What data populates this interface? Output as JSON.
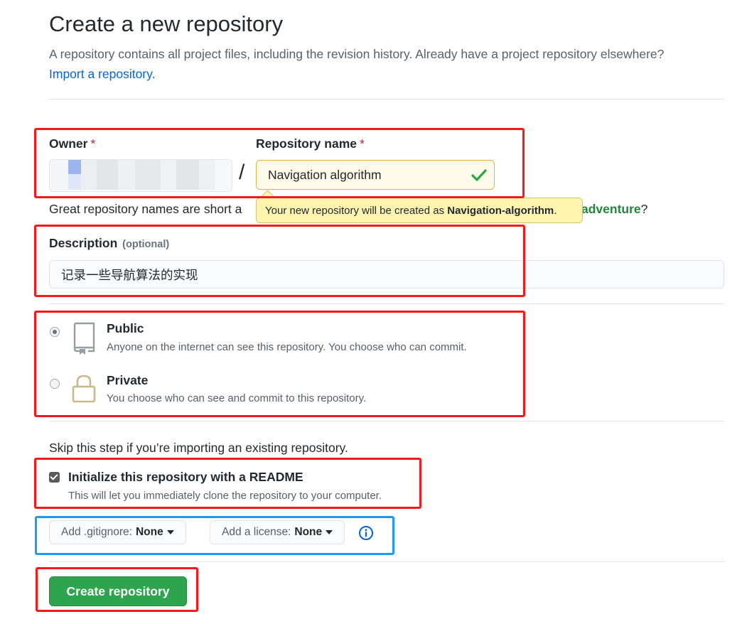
{
  "header": {
    "title": "Create a new repository",
    "subtitle": "A repository contains all project files, including the revision history. Already have a project repository elsewhere?",
    "import_link": "Import a repository."
  },
  "owner": {
    "label": "Owner",
    "required_mark": "*"
  },
  "separator": "/",
  "repo_name": {
    "label": "Repository name",
    "required_mark": "*",
    "value": "Navigation algorithm"
  },
  "hint": {
    "start": "Great repository names are short a",
    "end_highlight": "adventure",
    "end_suffix": "?"
  },
  "tooltip": {
    "prefix": "Your new repository will be created as ",
    "name": "Navigation-algorithm",
    "suffix": "."
  },
  "description": {
    "label": "Description",
    "optional": "(optional)",
    "value": "记录一些导航算法的实现"
  },
  "visibility": {
    "public": {
      "title": "Public",
      "desc": "Anyone on the internet can see this repository. You choose who can commit.",
      "selected": true
    },
    "private": {
      "title": "Private",
      "desc": "You choose who can see and commit to this repository.",
      "selected": false
    }
  },
  "init": {
    "skip_text": "Skip this step if you’re importing an existing repository.",
    "readme_label": "Initialize this repository with a README",
    "readme_desc": "This will let you immediately clone the repository to your computer.",
    "readme_checked": true
  },
  "gitignore": {
    "label": "Add .gitignore:",
    "value": "None"
  },
  "license": {
    "label": "Add a license:",
    "value": "None"
  },
  "submit": {
    "label": "Create repository"
  },
  "colors": {
    "primary_button": "#2ea44f",
    "link": "#0366d6",
    "required": "#cb2431",
    "valid_check": "#28a745",
    "highlight_red": "#f41a1a",
    "highlight_blue": "#1e9bf0"
  }
}
